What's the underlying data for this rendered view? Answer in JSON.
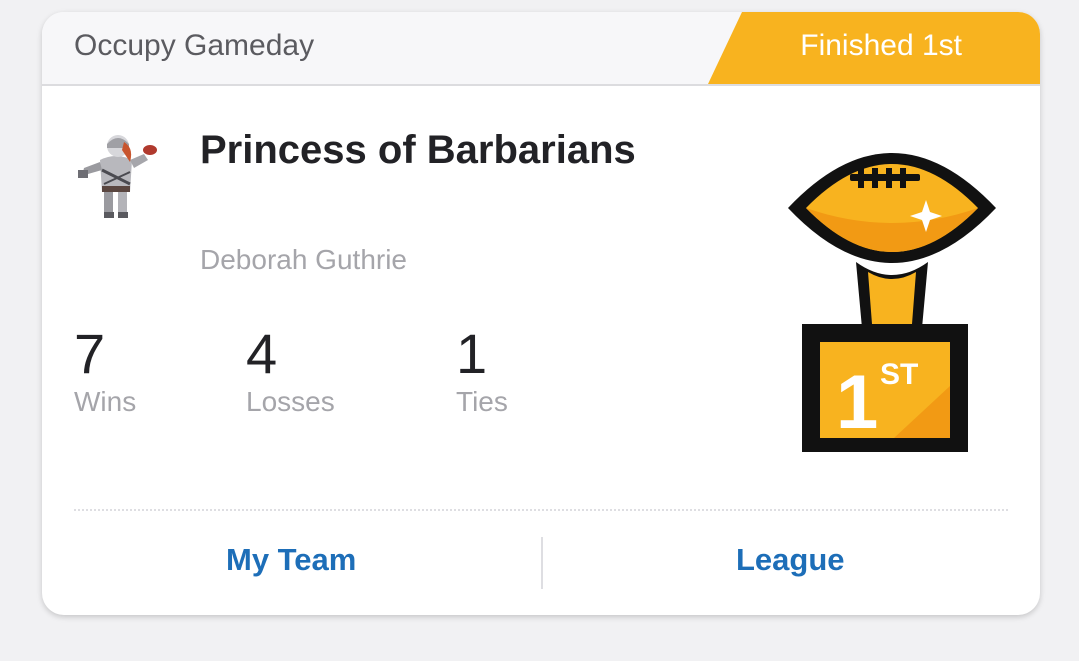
{
  "header": {
    "league_name": "Occupy Gameday",
    "finish_badge": "Finished 1st"
  },
  "team": {
    "name": "Princess of Barbarians",
    "owner": "Deborah Guthrie",
    "avatar_icon": "barbarian-princess-avatar-icon"
  },
  "record": {
    "wins": {
      "value": "7",
      "label": "Wins"
    },
    "losses": {
      "value": "4",
      "label": "Losses"
    },
    "ties": {
      "value": "1",
      "label": "Ties"
    }
  },
  "trophy": {
    "icon": "first-place-football-trophy-icon",
    "place_text": "1",
    "place_suffix": "ST"
  },
  "footer": {
    "my_team_label": "My Team",
    "league_label": "League"
  },
  "colors": {
    "accent_gold": "#f8b31f",
    "link_blue": "#1d6eb8",
    "text_dark": "#222226",
    "text_muted": "#a5a5aa"
  }
}
